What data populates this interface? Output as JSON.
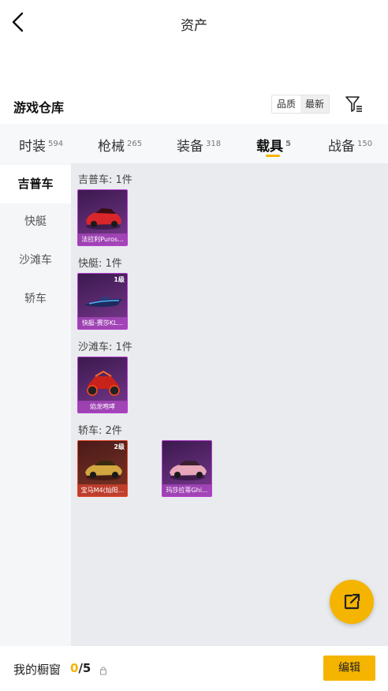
{
  "header": {
    "title": "资产"
  },
  "warehouse": {
    "title": "游戏仓库",
    "sort_options": [
      "品质",
      "最新"
    ]
  },
  "tabs": [
    {
      "label": "时装",
      "count": "594"
    },
    {
      "label": "枪械",
      "count": "265"
    },
    {
      "label": "装备",
      "count": "318"
    },
    {
      "label": "载具",
      "count": "5"
    },
    {
      "label": "战备",
      "count": "150"
    }
  ],
  "sidebar": {
    "items": [
      {
        "label": "吉普车"
      },
      {
        "label": "快艇"
      },
      {
        "label": "沙滩车"
      },
      {
        "label": "轿车"
      }
    ]
  },
  "groups": [
    {
      "title": "吉普车: 1件",
      "items": [
        {
          "name": "法拉利Puros...",
          "level": ""
        }
      ]
    },
    {
      "title": "快艇: 1件",
      "items": [
        {
          "name": "快艇-赛莎KL...",
          "level": "1级"
        }
      ]
    },
    {
      "title": "沙滩车: 1件",
      "items": [
        {
          "name": "焰龙咆哮",
          "level": ""
        }
      ]
    },
    {
      "title": "轿车: 2件",
      "items": [
        {
          "name": "宝马M4(灿阳...",
          "level": "2级"
        },
        {
          "name": "玛莎拉蒂Ghi...",
          "level": ""
        }
      ]
    }
  ],
  "showcase": {
    "label": "我的橱窗",
    "current": "0",
    "total": "/5"
  },
  "edit_button": "编辑",
  "colors": {
    "accent": "#f5b400",
    "epic_purple": "#b43fd0",
    "legend_orange": "#e04a2a"
  },
  "icons": [
    "back-arrow-icon",
    "filter-icon",
    "share-export-icon",
    "lock-icon"
  ]
}
